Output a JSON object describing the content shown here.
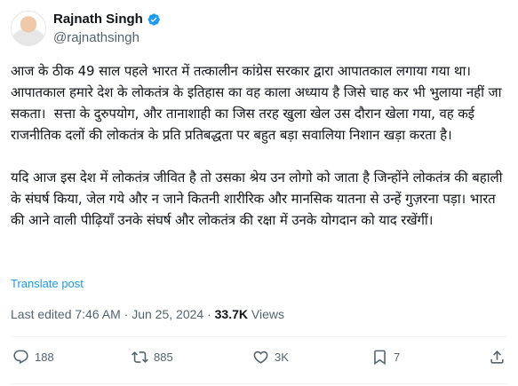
{
  "author": {
    "name": "Rajnath Singh",
    "handle": "@rajnathsingh",
    "verified_color": "#1d9bf0"
  },
  "tweet": {
    "paragraph1": "आज के ठीक 49 साल पहले भारत में तत्कालीन कांग्रेस सरकार द्वारा आपातकाल लगाया गया था। आपातकाल हमारे देश के लोकतंत्र के इतिहास का वह काला अध्याय है जिसे चाह कर भी भुलाया नहीं जा सकता।  सत्ता के दुरुपयोग, और तानाशाही का जिस तरह खुला खेल उस दौरान खेला गया, वह कई राजनीतिक दलों की लोकतंत्र के प्रति प्रतिबद्धता पर बहुत बड़ा सवालिया निशान खड़ा करता है।",
    "paragraph2": "यदि आज इस देश में लोकतंत्र जीवित है तो उसका श्रेय उन लोगो को जाता है जिन्होंने लोकतंत्र की बहाली के संघर्ष किया, जेल गये और न जाने कितनी शारीरिक और मानसिक यातना से उन्हें गुज़रना पड़ा। भारत की आने वाली पीढ़ियाँ उनके संघर्ष और लोकतंत्र की रक्षा में उनके योगदान को याद रखेंगीं।",
    "translate_label": "Translate post"
  },
  "meta": {
    "edited_label": "Last edited 7:46 AM",
    "separator": " · ",
    "date": "Jun 25, 2024",
    "views_count": "33.7K",
    "views_label": "Views"
  },
  "actions": {
    "replies": "188",
    "reposts": "885",
    "likes": "3K",
    "bookmarks": "7"
  },
  "colors": {
    "text": "#0f1419",
    "secondary": "#536471",
    "link": "#1d9bf0",
    "divider": "#eff3f4"
  }
}
